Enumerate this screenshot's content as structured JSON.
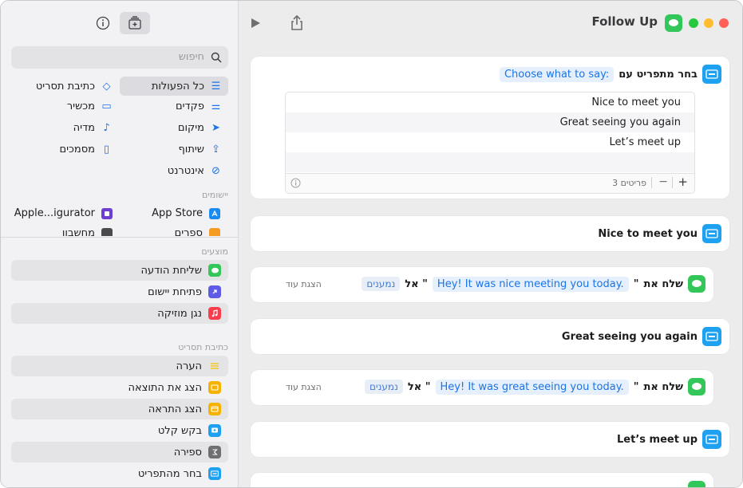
{
  "toolbar": {
    "title": "Follow Up"
  },
  "sidebar": {
    "search_placeholder": "חיפוש",
    "categories": {
      "all_actions": "כל הפעולות",
      "scripting": "כתיבת תסריט",
      "controls": "פקדים",
      "device": "מכשיר",
      "location": "מיקום",
      "media": "מדיה",
      "sharing": "שיתוף",
      "documents": "מסמכים",
      "web": "אינטרנט"
    },
    "apps_header": "יישומים",
    "apps": [
      "App Store",
      "Apple...igurator",
      "ספרים",
      "מחשבון"
    ],
    "suggested_header": "מוצעים",
    "suggested": [
      "שליחת הודעה",
      "פתיחת יישום",
      "נגן מוזיקה"
    ],
    "scripting_header": "כתיבת תסריט",
    "scripting_items": [
      "הערה",
      "הצג את התוצאה",
      "הצג התראה",
      "בקש קלט",
      "ספירה",
      "בחר מהתפריט"
    ]
  },
  "editor": {
    "menu_action": {
      "label": "בחר מתפריט עם",
      "prompt": "Choose what to say:",
      "items": [
        "Nice to meet you",
        "Great seeing you again",
        "Let’s meet up"
      ],
      "count": "3 פריטים"
    },
    "cases": [
      {
        "title": "Nice to meet you",
        "send": "שלח את",
        "quote_open": "\"",
        "message": "Hey! It was nice meeting you today.",
        "quote_close": "\" אל",
        "recipients": "נמענים",
        "show_more": "הצגת עוד"
      },
      {
        "title": "Great seeing you again",
        "send": "שלח את",
        "quote_open": "\"",
        "message": "Hey! It was great seeing you today.",
        "quote_close": "\" אל",
        "recipients": "נמענים",
        "show_more": "הצגת עוד"
      },
      {
        "title": "Let’s meet up"
      }
    ]
  },
  "colors": {
    "accent": "#1a73e8",
    "action_blue": "#1ea1f1",
    "messages_green": "#33c759"
  }
}
